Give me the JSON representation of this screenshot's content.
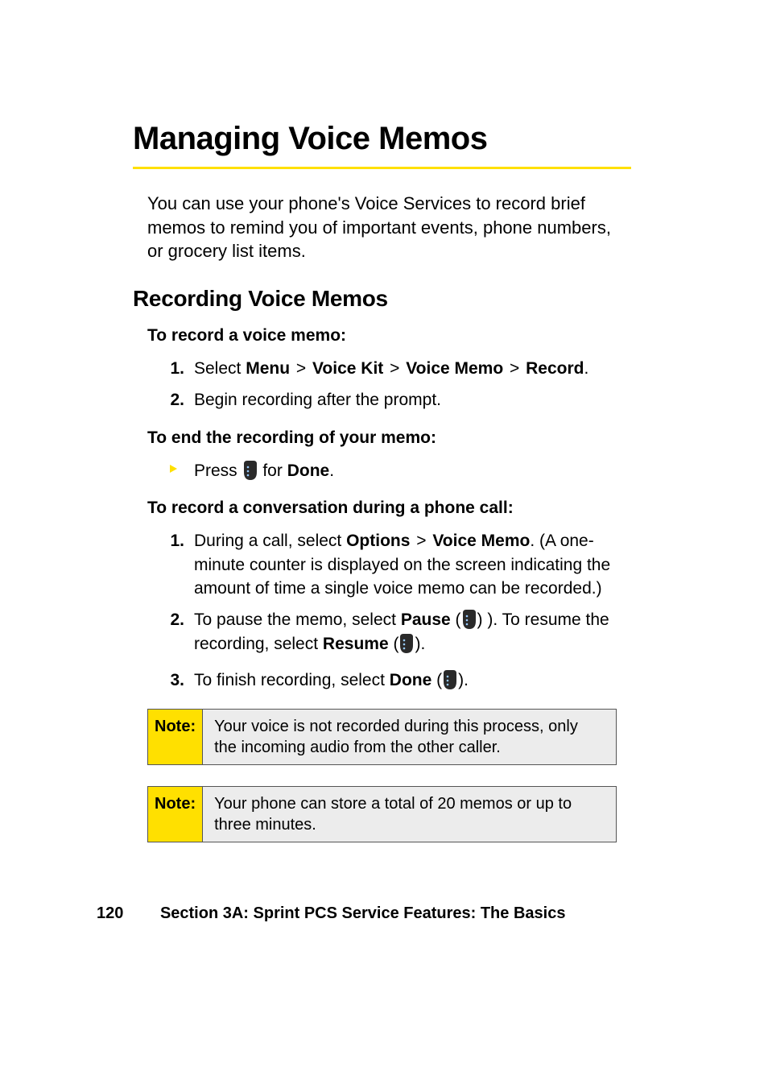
{
  "title": "Managing Voice Memos",
  "intro": "You can use your phone's Voice Services to record brief memos to remind you of important events, phone numbers, or grocery list items.",
  "subhead": "Recording Voice Memos",
  "lead1": "To record a voice memo:",
  "step1": {
    "num": "1.",
    "pre": "Select ",
    "menu": "Menu",
    "gt1": " > ",
    "vkit": "Voice Kit",
    "gt2": " > ",
    "vmemo": "Voice Memo",
    "gt3": " > ",
    "record": "Record",
    "post": "."
  },
  "step2": {
    "num": "2.",
    "text": "Begin recording after the prompt."
  },
  "lead2": "To end the recording of your memo:",
  "pressline": {
    "pre": "Press ",
    "mid": " for ",
    "done": "Done",
    "post": "."
  },
  "lead3": "To record a conversation during a phone call:",
  "conv1": {
    "num": "1.",
    "pre": "During a call, select ",
    "options": "Options",
    "gt": " > ",
    "vmemo": "Voice Memo",
    "post": ". (A one-minute counter is displayed on the screen indicating the amount of time a single voice memo can be recorded.)"
  },
  "conv2": {
    "num": "2.",
    "pre": "To pause the memo, select ",
    "pause": "Pause",
    "mid1": " ( ",
    "mid2": " ). To resume the recording, select ",
    "resume": "Resume",
    "mid3": " ( ",
    "post": " )."
  },
  "conv3": {
    "num": "3.",
    "pre": "To finish recording, select ",
    "done": "Done",
    "mid": " ( ",
    "post": " )."
  },
  "noteLabel": "Note:",
  "note1": "Your voice is not recorded during this process, only the incoming audio from the other caller.",
  "note2": "Your phone can store a total of 20 memos or up to three minutes.",
  "footer": {
    "page": "120",
    "section": "Section 3A: Sprint PCS Service Features: The Basics"
  }
}
